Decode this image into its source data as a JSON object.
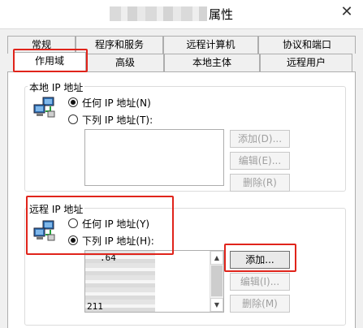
{
  "window": {
    "title": "属性",
    "close_glyph": "✕"
  },
  "tabs": {
    "row1": [
      "常规",
      "程序和服务",
      "远程计算机",
      "协议和端口"
    ],
    "row2": [
      "作用域",
      "高级",
      "本地主体",
      "远程用户"
    ],
    "selected": "作用域"
  },
  "local_ip": {
    "title": "本地 IP 地址",
    "option_any": "任何 IP 地址(N)",
    "option_list": "下列 IP 地址(T):",
    "selected": "any",
    "buttons": {
      "add": "添加(D)...",
      "edit": "编辑(E)...",
      "delete": "删除(R)"
    }
  },
  "remote_ip": {
    "title": "远程 IP 地址",
    "option_any": "任何 IP 地址(Y)",
    "option_list": "下列 IP 地址(H):",
    "selected": "list",
    "list_items": [
      ".64",
      "211"
    ],
    "buttons": {
      "add": "添加...",
      "edit": "编辑(I)...",
      "delete": "删除(M)"
    }
  },
  "icons": [
    "network-computers-icon",
    "close-icon",
    "scroll-up-icon",
    "scroll-down-icon"
  ],
  "colors": {
    "highlight": "#e0241b",
    "selection": "#ffffff"
  }
}
